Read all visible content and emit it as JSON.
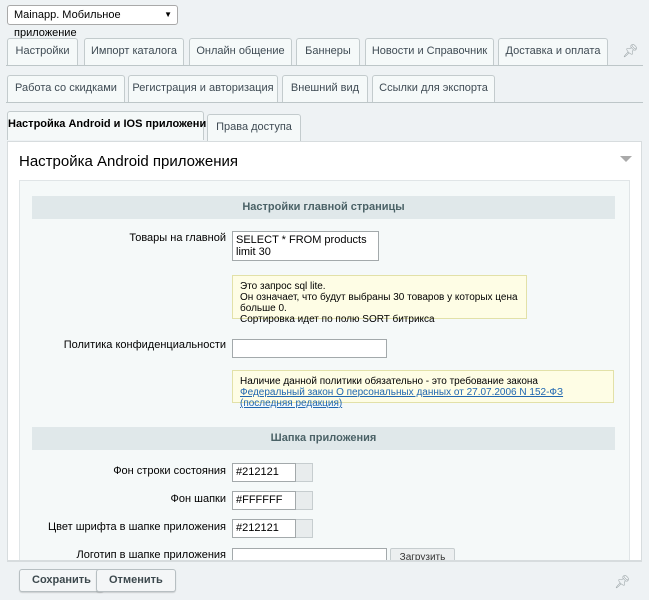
{
  "site_selector": {
    "value": "Mainapp. Мобильное приложение"
  },
  "tabs_row1": [
    {
      "label": "Настройки"
    },
    {
      "label": "Импорт каталога"
    },
    {
      "label": "Онлайн общение"
    },
    {
      "label": "Баннеры"
    },
    {
      "label": "Новости и Справочник"
    },
    {
      "label": "Доставка и оплата"
    }
  ],
  "tabs_row2": [
    {
      "label": "Работа со скидками"
    },
    {
      "label": "Регистрация и авторизация"
    },
    {
      "label": "Внешний вид"
    },
    {
      "label": "Ссылки для экспорта"
    }
  ],
  "tabs_row3": [
    {
      "label": "Настройка Android и IOS приложений"
    },
    {
      "label": "Права доступа"
    }
  ],
  "panel": {
    "title": "Настройка Android приложения"
  },
  "section_main": {
    "heading": "Настройки главной страницы",
    "products_label": "Товары на главной",
    "products_value": "SELECT * FROM products limit 30",
    "products_hint_line1": "Это запрос sql lite.",
    "products_hint_line2": "Он означает, что будут выбраны 30 товаров у которых цена больше 0.",
    "products_hint_line3": "Сортировка идет по полю SORT битрикса",
    "privacy_label": "Политика конфиденциальности",
    "privacy_value": "",
    "privacy_hint_line1": "Наличие данной политики обязательно - это требование закона",
    "privacy_hint_link": "Федеральный закон О персональных данных от 27.07.2006 N 152-ФЗ (последняя редакция)"
  },
  "section_header": {
    "heading": "Шапка приложения",
    "statusbar_label": "Фон строки состояния",
    "statusbar_value": "#212121",
    "header_bg_label": "Фон шапки",
    "header_bg_value": "#FFFFFF",
    "header_font_label": "Цвет шрифта в шапке приложения",
    "header_font_value": "#212121",
    "logo_label": "Логотип в шапке приложения",
    "upload_label": "Загрузить"
  },
  "footer": {
    "save_label": "Сохранить",
    "cancel_label": "Отменить"
  },
  "colors": {
    "accent_link": "#2067b0",
    "hint_bg": "#fefde5"
  }
}
